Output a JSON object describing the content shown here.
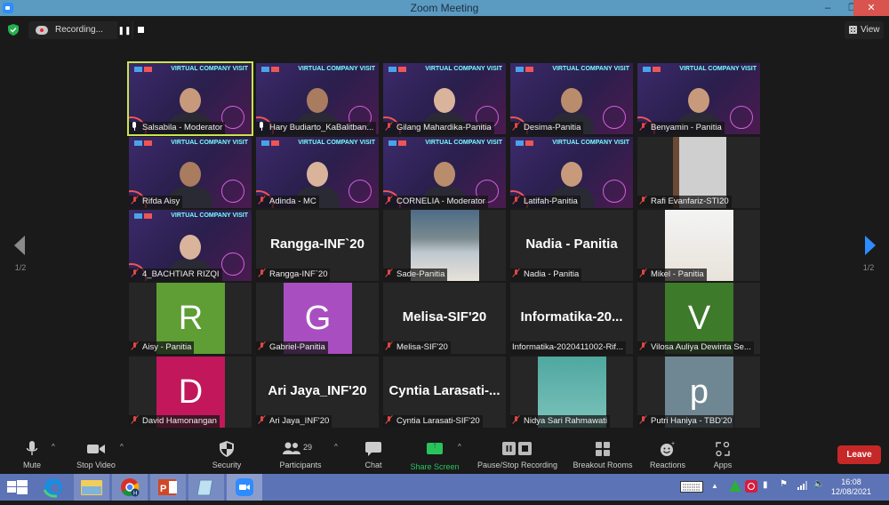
{
  "window": {
    "title": "Zoom Meeting",
    "minimize": "–",
    "maximize": "❐",
    "close": "✕"
  },
  "topbar": {
    "recording_label": "Recording...",
    "pause_icon": "❚❚",
    "view_label": "View"
  },
  "pagination": {
    "left": "1/2",
    "right": "1/2"
  },
  "tiles": [
    {
      "name": "Salsabila - Moderator",
      "mic": "live",
      "kind": "vcv",
      "active": true
    },
    {
      "name": "Hary Budiarto_KaBalitban...",
      "mic": "live",
      "kind": "vcv"
    },
    {
      "name": "Gilang Mahardika-Panitia",
      "mic": "muted",
      "kind": "vcv"
    },
    {
      "name": "Desima-Panitia",
      "mic": "muted",
      "kind": "vcv"
    },
    {
      "name": "Benyamin - Panitia",
      "mic": "muted",
      "kind": "vcv"
    },
    {
      "name": "Rifda Aisy",
      "mic": "muted",
      "kind": "vcv"
    },
    {
      "name": "Adinda - MC",
      "mic": "muted",
      "kind": "vcv"
    },
    {
      "name": "CORNELIA - Moderator",
      "mic": "muted",
      "kind": "vcv"
    },
    {
      "name": "Latifah-Panitia",
      "mic": "muted",
      "kind": "vcv"
    },
    {
      "name": "Rafi Evanfariz-STI20",
      "mic": "muted",
      "kind": "video"
    },
    {
      "name": "4_BACHTIAR RIZQI",
      "mic": "muted",
      "kind": "vcv"
    },
    {
      "name": "Rangga-INF`20",
      "mic": "muted",
      "kind": "text",
      "big": "Rangga-INF`20"
    },
    {
      "name": "Sade-Panitia",
      "mic": "muted",
      "kind": "photo"
    },
    {
      "name": "Nadia - Panitia",
      "mic": "muted",
      "kind": "text",
      "big": "Nadia - Panitia"
    },
    {
      "name": "Mikel - Panitia",
      "mic": "muted",
      "kind": "photo"
    },
    {
      "name": "Aisy - Panitia",
      "mic": "muted",
      "kind": "avatar",
      "initial": "R",
      "color": "#5e9e35"
    },
    {
      "name": "Gabriel-Panitia",
      "mic": "muted",
      "kind": "avatar",
      "initial": "G",
      "color": "#a94ec0"
    },
    {
      "name": "Melisa-SIF'20",
      "mic": "muted",
      "kind": "text",
      "big": "Melisa-SIF'20"
    },
    {
      "name": "Informatika-2020411002-Rif...",
      "mic": "none",
      "kind": "text",
      "big": "Informatika-20..."
    },
    {
      "name": "Vilosa Auliya Dewinta Se...",
      "mic": "muted",
      "kind": "avatar",
      "initial": "V",
      "color": "#3d7a2a"
    },
    {
      "name": "David Hamonangan",
      "mic": "muted",
      "kind": "avatar",
      "initial": "D",
      "color": "#c2185b"
    },
    {
      "name": "Ari Jaya_INF'20",
      "mic": "muted",
      "kind": "text",
      "big": "Ari Jaya_INF'20"
    },
    {
      "name": "Cyntia Larasati-SIF'20",
      "mic": "muted",
      "kind": "text",
      "big": "Cyntia  Larasati-..."
    },
    {
      "name": "Nidya Sari Rahmawati",
      "mic": "muted",
      "kind": "photo"
    },
    {
      "name": "Putri Haniya - TBD'20",
      "mic": "muted",
      "kind": "avatar",
      "initial": "p",
      "color": "#6f8793"
    }
  ],
  "vcv_banner": "VIRTUAL COMPANY VISIT",
  "toolbar": {
    "mute": "Mute",
    "stop_video": "Stop Video",
    "security": "Security",
    "participants": "Participants",
    "participants_count": "29",
    "chat": "Chat",
    "share_screen": "Share Screen",
    "pause_stop_recording": "Pause/Stop Recording",
    "breakout_rooms": "Breakout Rooms",
    "reactions": "Reactions",
    "apps": "Apps",
    "leave": "Leave",
    "caret": "^"
  },
  "taskbar": {
    "apps": [
      "windows-start",
      "edge",
      "file-explorer",
      "chrome",
      "powerpoint",
      "notepad",
      "zoom"
    ],
    "time": "16:08",
    "date": "12/08/2021"
  },
  "colors": {
    "accent": "#2d8cff",
    "share_green": "#29c35c",
    "leave_red": "#c62828",
    "active_speaker": "#c8e64a"
  }
}
